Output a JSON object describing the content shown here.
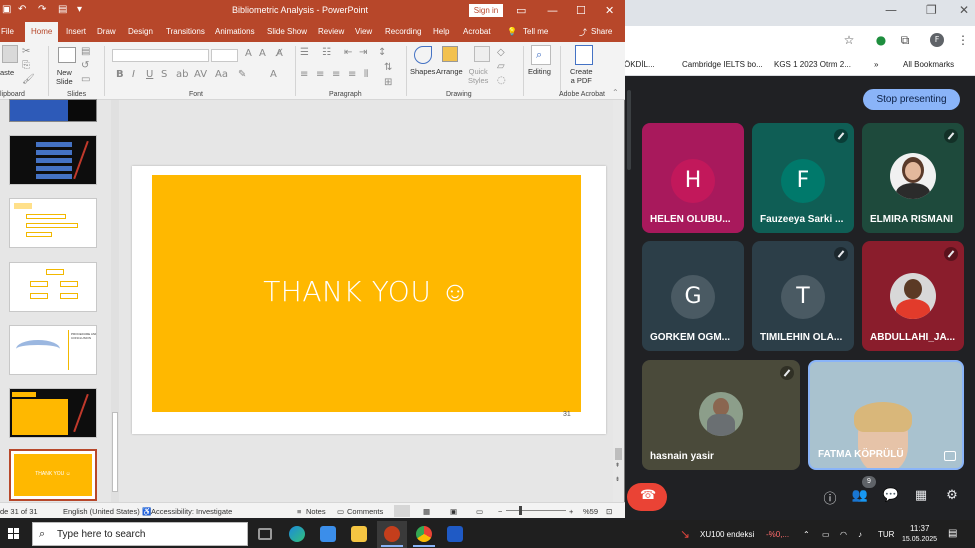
{
  "powerpoint": {
    "title": "Bibliometric Analysis  -  PowerPoint",
    "sign_in": "Sign in",
    "tabs": [
      "File",
      "Home",
      "Insert",
      "Draw",
      "Design",
      "Transitions",
      "Animations",
      "Slide Show",
      "Review",
      "View",
      "Recording",
      "Help",
      "Acrobat"
    ],
    "tell_me": "Tell me",
    "share": "Share",
    "ribbon": {
      "paste": "aste",
      "new_slide": "New\nSlide",
      "shapes": "Shapes",
      "arrange": "Arrange",
      "quick_styles": "Quick\nStyles",
      "editing": "Editing",
      "create_pdf": "Create\na PDF",
      "groups": [
        "lipboard",
        "Slides",
        "Font",
        "Paragraph",
        "Drawing",
        "Adobe Acrobat"
      ]
    },
    "thumb_texts": {
      "t5": "PROCEDURE AND\nCONCLUSION",
      "t7": "THANK YOU ☺"
    },
    "slide": {
      "text": "THANK YOU ☺",
      "number": "31",
      "bg_color": "#ffb800"
    },
    "status": {
      "slide_of": "de 31 of 31",
      "language": "English (United States)",
      "accessibility": "Accessibility: Investigate",
      "notes": "Notes",
      "comments": "Comments",
      "zoom": "%59"
    }
  },
  "browser": {
    "bookmarks": [
      "ÖKDİL...",
      "Cambridge IELTS bo...",
      "KGS 1 2023 Otrm 2...",
      "»",
      "All Bookmarks"
    ]
  },
  "meet": {
    "stop_presenting": "Stop presenting",
    "participants": [
      {
        "name": "HELEN OLUBU...",
        "initial": "H",
        "bg": "#a8195c",
        "avatar": "#c2185b"
      },
      {
        "name": "Fauzeeya Sarki ...",
        "initial": "F",
        "bg": "#0f5e55",
        "avatar": "#00796b"
      },
      {
        "name": "ELMIRA RISMANI",
        "initial": "",
        "bg": "#1e4a3c",
        "avatar": ""
      },
      {
        "name": "GORKEM OGM...",
        "initial": "G",
        "bg": "#2c3e48",
        "avatar": "#4a5a63"
      },
      {
        "name": "TIMILEHIN OLA...",
        "initial": "T",
        "bg": "#2c3e48",
        "avatar": "#4a5a63"
      },
      {
        "name": "ABDULLAHI_JA...",
        "initial": "",
        "bg": "#8a1d2c",
        "avatar": ""
      },
      {
        "name": "hasnain yasir",
        "initial": "",
        "bg": "#4a4a3a",
        "avatar": ""
      },
      {
        "name": "FATMA KÖPRÜLÜ",
        "initial": "",
        "bg": "#9fb7c4",
        "avatar": ""
      }
    ],
    "participant_count": "9"
  },
  "taskbar": {
    "search_placeholder": "Type here to search",
    "ticker": "XU100 endeksi",
    "ticker_val": "-%0,...",
    "lang": "TUR",
    "time": "11:37",
    "date": "15.05.2025"
  }
}
